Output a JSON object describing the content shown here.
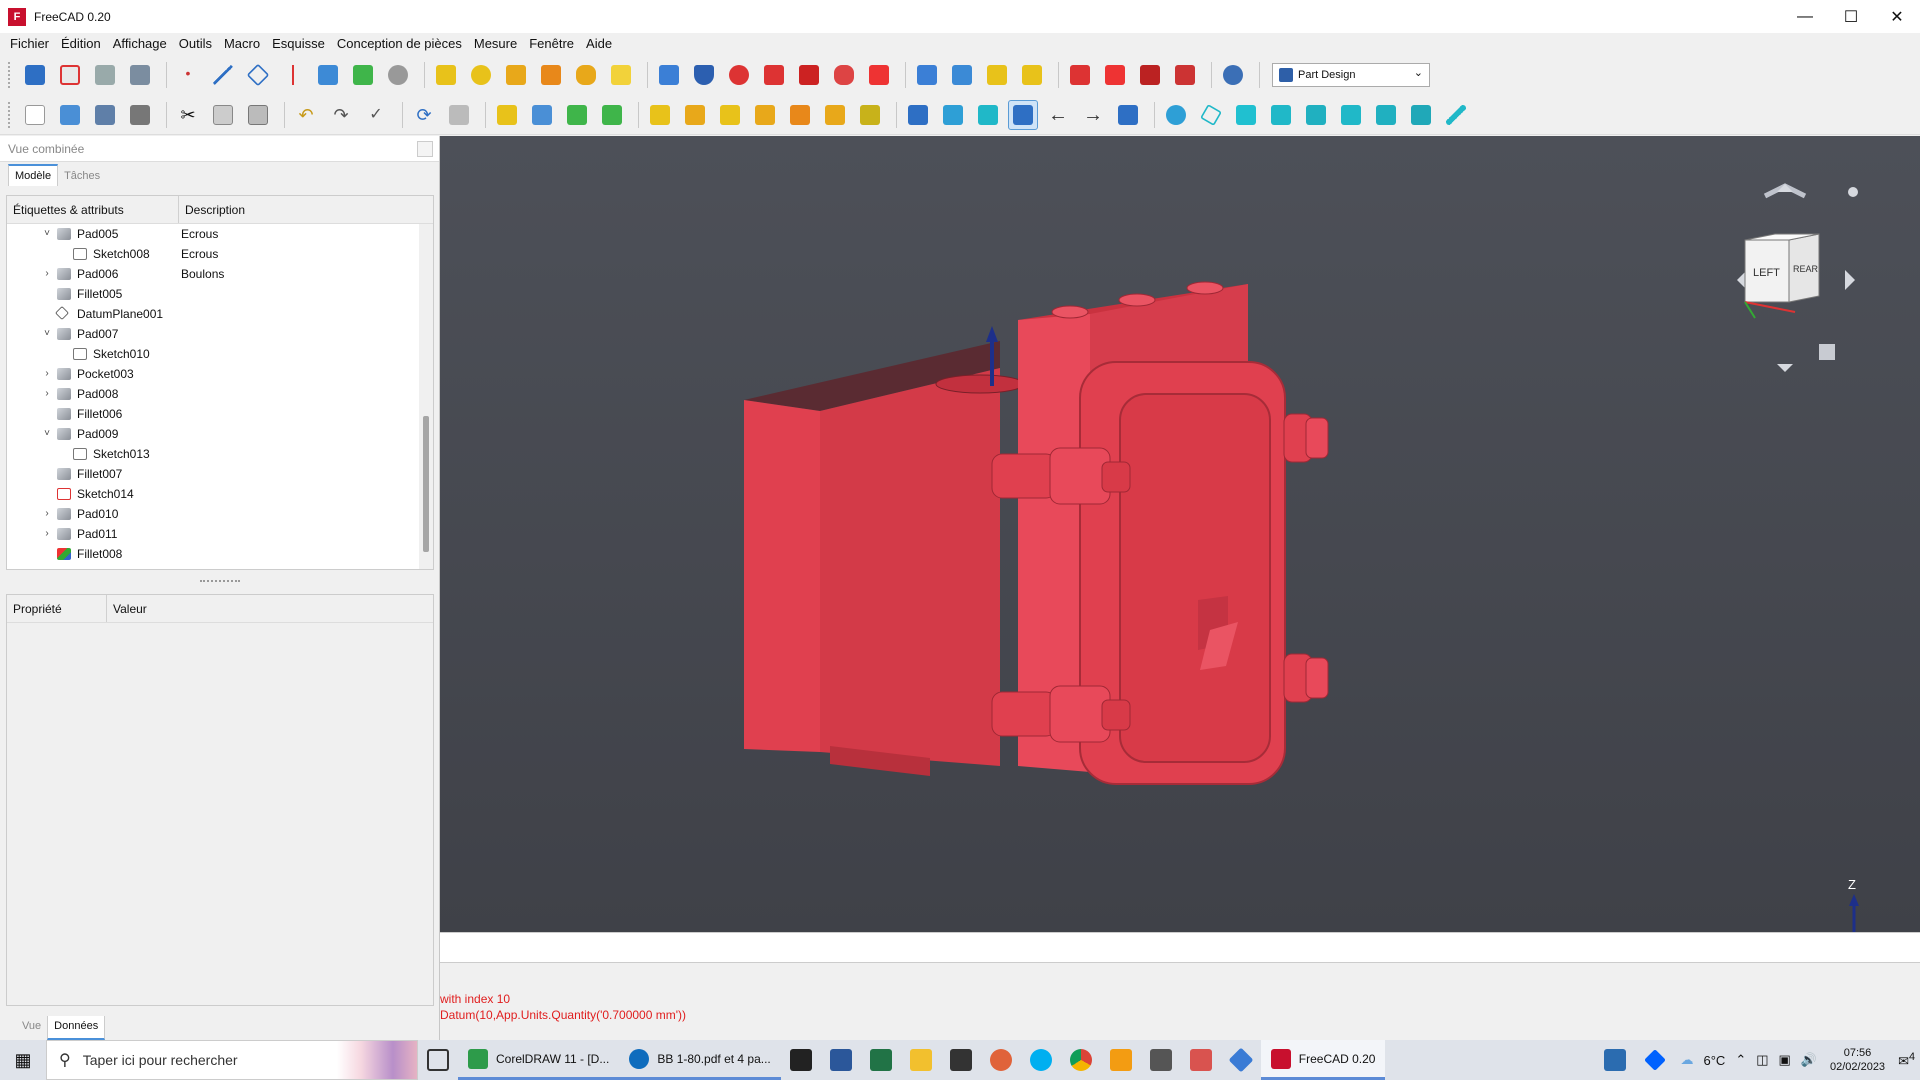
{
  "window": {
    "title": "FreeCAD 0.20",
    "logo": "F"
  },
  "menu": [
    "Fichier",
    "Édition",
    "Affichage",
    "Outils",
    "Macro",
    "Esquisse",
    "Conception de pièces",
    "Mesure",
    "Fenêtre",
    "Aide"
  ],
  "workbench": {
    "selected": "Part Design"
  },
  "combo": {
    "placeholder": "Vue combinée",
    "tabs": [
      "Modèle",
      "Tâches"
    ]
  },
  "tree": {
    "columns": [
      "Étiquettes & attributs",
      "Description"
    ],
    "rows": [
      {
        "label": "Pad005",
        "desc": "Ecrous",
        "level": 1,
        "expand": "open",
        "icon": "pad"
      },
      {
        "label": "Sketch008",
        "desc": "Ecrous",
        "level": 2,
        "expand": "",
        "icon": "sketch-warning"
      },
      {
        "label": "Pad006",
        "desc": "Boulons",
        "level": 1,
        "expand": "closed",
        "icon": "pad"
      },
      {
        "label": "Fillet005",
        "desc": "",
        "level": 1,
        "expand": "",
        "icon": "pad"
      },
      {
        "label": "DatumPlane001",
        "desc": "",
        "level": 1,
        "expand": "",
        "icon": "datum"
      },
      {
        "label": "Pad007",
        "desc": "",
        "level": 1,
        "expand": "open",
        "icon": "pad"
      },
      {
        "label": "Sketch010",
        "desc": "",
        "level": 2,
        "expand": "",
        "icon": "sketch"
      },
      {
        "label": "Pocket003",
        "desc": "",
        "level": 1,
        "expand": "closed",
        "icon": "pad"
      },
      {
        "label": "Pad008",
        "desc": "",
        "level": 1,
        "expand": "closed",
        "icon": "pad"
      },
      {
        "label": "Fillet006",
        "desc": "",
        "level": 1,
        "expand": "",
        "icon": "pad"
      },
      {
        "label": "Pad009",
        "desc": "",
        "level": 1,
        "expand": "open",
        "icon": "pad"
      },
      {
        "label": "Sketch013",
        "desc": "",
        "level": 2,
        "expand": "",
        "icon": "sketch"
      },
      {
        "label": "Fillet007",
        "desc": "",
        "level": 1,
        "expand": "",
        "icon": "pad"
      },
      {
        "label": "Sketch014",
        "desc": "",
        "level": 1,
        "expand": "",
        "icon": "sketch-red"
      },
      {
        "label": "Pad010",
        "desc": "",
        "level": 1,
        "expand": "closed",
        "icon": "pad"
      },
      {
        "label": "Pad011",
        "desc": "",
        "level": 1,
        "expand": "closed",
        "icon": "pad"
      },
      {
        "label": "Fillet008",
        "desc": "",
        "level": 1,
        "expand": "",
        "icon": "fillet-tip"
      }
    ]
  },
  "properties": {
    "columns": [
      "Propriété",
      "Valeur"
    ]
  },
  "bottom_tabs": [
    "Vue",
    "Données"
  ],
  "navcube": {
    "left": "LEFT",
    "rear": "REAR"
  },
  "axis": {
    "z": "Z"
  },
  "report": {
    "line1": "with index 10",
    "line2": "Datum(10,App.Units.Quantity('0.700000 mm'))"
  },
  "colors": {
    "model": "#e0404f",
    "viewport_top": "#4d5058",
    "report_text": "#e01e1e"
  },
  "taskbar": {
    "search_placeholder": "Taper ici pour rechercher",
    "apps": [
      {
        "label": "CorelDRAW 11 - [D...",
        "color": "#2d9b4a"
      },
      {
        "label": "BB 1-80.pdf et 4 pa...",
        "color": "#0f6cbd"
      },
      {
        "label": "FreeCAD 0.20",
        "color": "#c8102e"
      }
    ],
    "weather": "6°C",
    "time": "07:56",
    "date": "02/02/2023",
    "notifications": "4"
  }
}
